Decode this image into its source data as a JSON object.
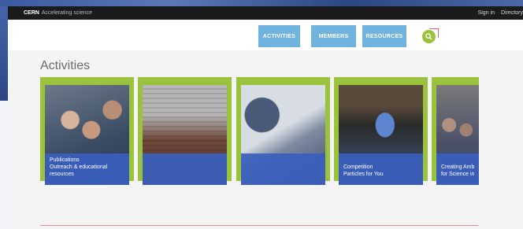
{
  "topbar": {
    "brand": "CERN",
    "tagline": "Accelerating science",
    "links": [
      "Sign in",
      "Directory"
    ]
  },
  "nav": {
    "items": [
      "ACTIVITIES",
      "MEMBERS",
      "RESOURCES"
    ],
    "search_icon": "search-icon"
  },
  "section": {
    "title": "Activities",
    "cards": [
      {
        "lines": [
          "Publications",
          "Outreach & educational",
          "resources"
        ],
        "style": "normal"
      },
      {
        "lines": [
          "",
          ""
        ],
        "style": "dim"
      },
      {
        "lines": [
          "",
          ""
        ],
        "style": "dim"
      },
      {
        "lines": [
          "Competition",
          "Particles for You"
        ],
        "style": "normal"
      },
      {
        "lines": [
          "Creating Amb",
          "for Science in"
        ],
        "style": "normal"
      }
    ]
  },
  "colors": {
    "accent_green": "#9bc23c",
    "nav_blue": "#6fb3de",
    "overlay_blue": "#3a60be",
    "topbar": "#1b1b1b",
    "divider_pink": "#e3879a"
  }
}
